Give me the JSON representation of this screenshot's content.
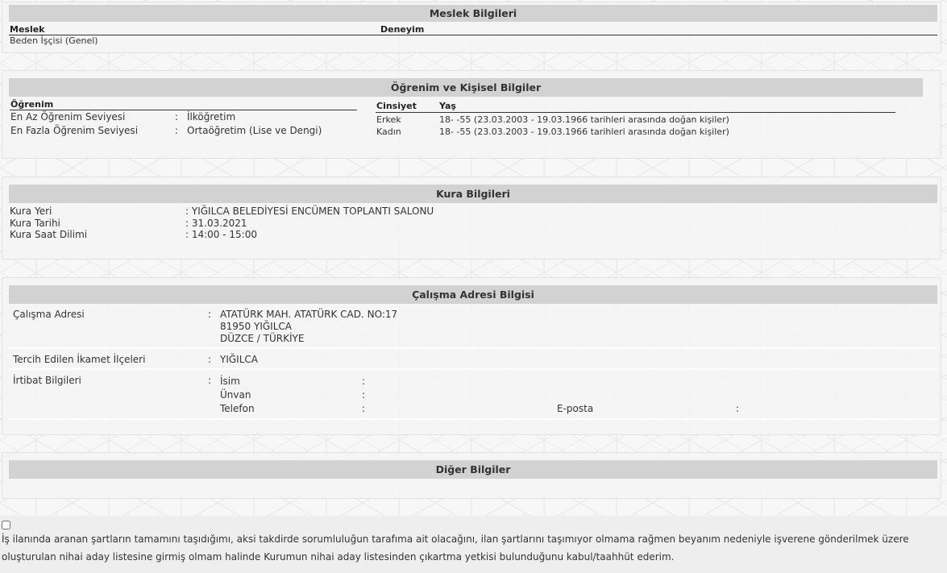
{
  "meslek": {
    "title": "Meslek Bilgileri",
    "col_meslek": "Meslek",
    "col_deneyim": "Deneyim",
    "rows": [
      {
        "meslek": "Beden İşçisi (Genel)",
        "deneyim": ""
      }
    ]
  },
  "ogrenim": {
    "title": "Öğrenim ve Kişisel Bilgiler",
    "col_ogrenim": "Öğrenim",
    "rows": [
      {
        "label": "En Az Öğrenim Seviyesi",
        "sep": ":",
        "value": "İlköğretim"
      },
      {
        "label": "En Fazla Öğrenim Seviyesi",
        "sep": ":",
        "value": "Ortaöğretim (Lise ve Dengi)"
      }
    ],
    "col_cinsiyet": "Cinsiyet",
    "col_yas": "Yaş",
    "kisisel": [
      {
        "cinsiyet": "Erkek",
        "yas": "18- -55 (23.03.2003 - 19.03.1966 tarihleri arasında doğan kişiler)"
      },
      {
        "cinsiyet": "Kadın",
        "yas": "18- -55 (23.03.2003 - 19.03.1966 tarihleri arasında doğan kişiler)"
      }
    ]
  },
  "kura": {
    "title": "Kura Bilgileri",
    "rows": [
      {
        "label": "Kura Yeri",
        "value": ": YIĞILCA BELEDİYESİ ENCÜMEN TOPLANTI SALONU"
      },
      {
        "label": "Kura Tarihi",
        "value": ": 31.03.2021"
      },
      {
        "label": "Kura Saat Dilimi",
        "value": ": 14:00 - 15:00"
      }
    ]
  },
  "adres": {
    "title": "Çalışma Adresi Bilgisi",
    "sep": ":",
    "calisma_label": "Çalışma Adresi",
    "calisma_lines": [
      "ATATÜRK MAH. ATATÜRK CAD. NO:17",
      "81950 YIĞILCA",
      "DÜZCE / TÜRKİYE"
    ],
    "ilce_label": "Tercih Edilen İkamet İlçeleri",
    "ilce_value": "YIĞILCA",
    "irtibat_label": "İrtibat Bilgileri",
    "isim_label": "İsim",
    "unvan_label": "Ünvan",
    "telefon_label": "Telefon",
    "eposta_label": "E-posta"
  },
  "diger": {
    "title": "Diğer Bilgiler"
  },
  "beyan": {
    "text": "İş ilanında aranan şartların tamamını taşıdığımı, aksi takdirde sorumluluğun tarafıma ait olacağını, ilan şartlarını taşımıyor olmama rağmen beyanım nedeniyle işverene gönderilmek üzere oluşturulan nihai aday listesine girmiş olmam halinde Kurumun nihai aday listesinden çıkartma yetkisi bulunduğunu kabul/taahhüt ederim."
  }
}
